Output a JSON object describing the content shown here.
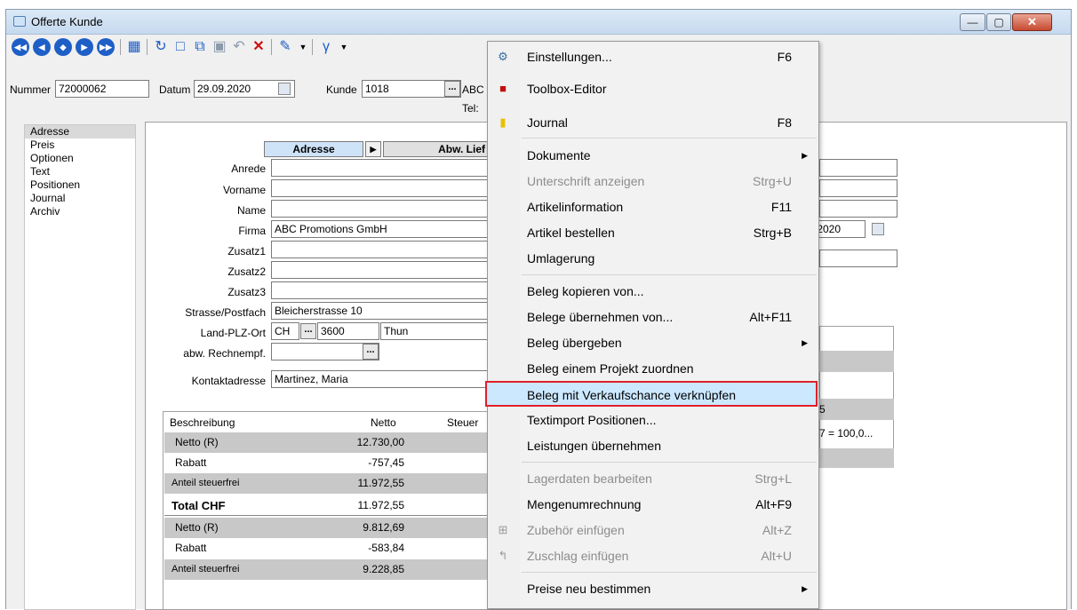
{
  "window": {
    "title": "Offerte Kunde"
  },
  "header": {
    "nummer_label": "Nummer",
    "nummer_value": "72000062",
    "datum_label": "Datum",
    "datum_value": "29.09.2020",
    "kunde_label": "Kunde",
    "kunde_value": "1018",
    "abc_text": "ABC",
    "tel_label": "Tel:"
  },
  "sidebar": {
    "items": [
      "Adresse",
      "Preis",
      "Optionen",
      "Text",
      "Positionen",
      "Journal",
      "Archiv"
    ]
  },
  "tabs": {
    "adresse": "Adresse",
    "abw": "Abw. Lief"
  },
  "form": {
    "anrede": "Anrede",
    "vorname": "Vorname",
    "name": "Name",
    "firma_label": "Firma",
    "firma_value": "ABC Promotions GmbH",
    "zusatz1": "Zusatz1",
    "zusatz2": "Zusatz2",
    "zusatz3": "Zusatz3",
    "strasse_label": "Strasse/Postfach",
    "strasse_value": "Bleicherstrasse 10",
    "land_label": "Land-PLZ-Ort",
    "land_value": "CH",
    "plz_value": "3600",
    "ort_value": "Thun",
    "abw_label": "abw. Rechnempf.",
    "kontakt_label": "Kontaktadresse",
    "kontakt_value": "Martinez, Maria",
    "right_date": ".2020"
  },
  "table": {
    "headers": [
      "Beschreibung",
      "Netto",
      "Steuer"
    ],
    "rows": [
      {
        "desc": "Netto (R)",
        "netto": "12.730,00"
      },
      {
        "desc": "Rabatt",
        "netto": "-757,45"
      },
      {
        "desc": "Anteil steuerfrei",
        "netto": "11.972,55"
      },
      {
        "desc": "Total CHF",
        "netto": "11.972,55"
      },
      {
        "desc": "Netto (R)",
        "netto": "9.812,69"
      },
      {
        "desc": "Rabatt",
        "netto": "-583,84"
      },
      {
        "desc": "Anteil steuerfrei",
        "netto": "9.228,85"
      }
    ],
    "right_snippet1": "5",
    "right_snippet2": "7 = 100,0..."
  },
  "menu": {
    "items": [
      {
        "label": "Einstellungen...",
        "shortcut": "F6"
      },
      {
        "label": "Toolbox-Editor",
        "shortcut": ""
      },
      {
        "label": "Journal",
        "shortcut": "F8"
      },
      {
        "label": "Dokumente",
        "shortcut": ""
      },
      {
        "label": "Unterschrift anzeigen",
        "shortcut": "Strg+U"
      },
      {
        "label": "Artikelinformation",
        "shortcut": "F11"
      },
      {
        "label": "Artikel bestellen",
        "shortcut": "Strg+B"
      },
      {
        "label": "Umlagerung",
        "shortcut": ""
      },
      {
        "label": "Beleg kopieren von...",
        "shortcut": ""
      },
      {
        "label": "Belege übernehmen von...",
        "shortcut": "Alt+F11"
      },
      {
        "label": "Beleg übergeben",
        "shortcut": ""
      },
      {
        "label": "Beleg einem Projekt zuordnen",
        "shortcut": ""
      },
      {
        "label": "Beleg mit Verkaufschance verknüpfen",
        "shortcut": ""
      },
      {
        "label": "Textimport Positionen...",
        "shortcut": ""
      },
      {
        "label": "Leistungen übernehmen",
        "shortcut": ""
      },
      {
        "label": "Lagerdaten bearbeiten",
        "shortcut": "Strg+L"
      },
      {
        "label": "Mengenumrechnung",
        "shortcut": "Alt+F9"
      },
      {
        "label": "Zubehör einfügen",
        "shortcut": "Alt+Z"
      },
      {
        "label": "Zuschlag einfügen",
        "shortcut": "Alt+U"
      },
      {
        "label": "Preise neu bestimmen",
        "shortcut": ""
      }
    ]
  },
  "colors": {
    "accent": "#1e5fc7",
    "highlight": "#cce8ff",
    "highlight_border": "#e0202a"
  }
}
